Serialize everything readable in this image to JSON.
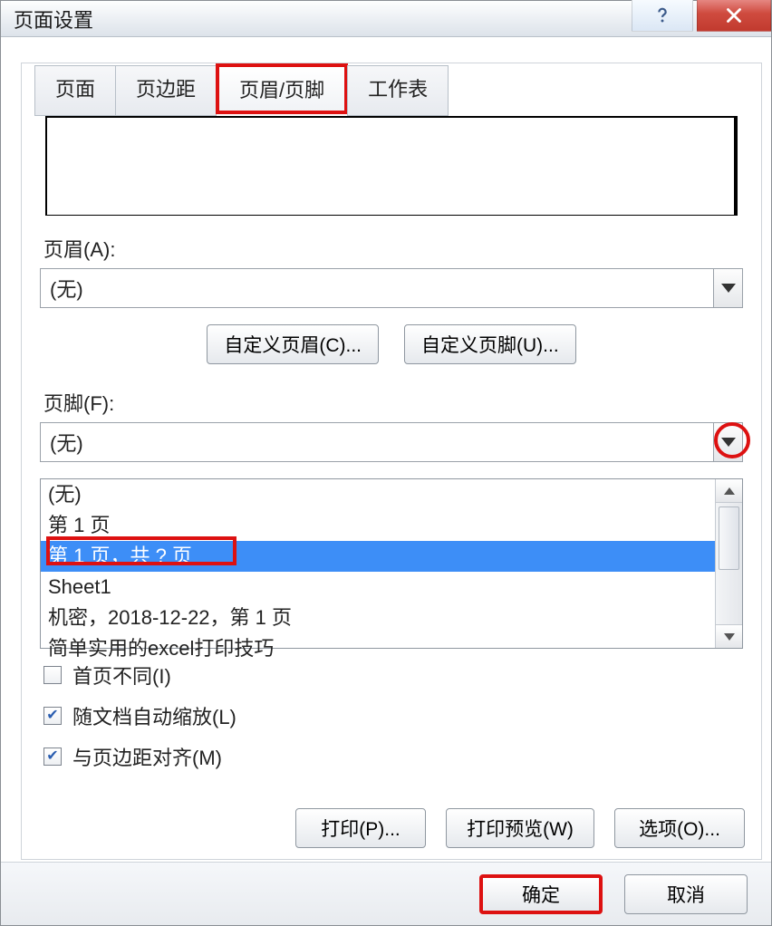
{
  "title": "页面设置",
  "tabs": {
    "page": "页面",
    "margins": "页边距",
    "headerFooter": "页眉/页脚",
    "sheet": "工作表"
  },
  "header": {
    "label": "页眉(A):",
    "value": "(无)"
  },
  "customHeaderBtn": "自定义页眉(C)...",
  "customFooterBtn": "自定义页脚(U)...",
  "footer": {
    "label": "页脚(F):",
    "value": "(无)"
  },
  "footerOptions": {
    "none": "(无)",
    "p1": "第 1 页",
    "p1ofN": "第 1 页，共 ? 页",
    "sheet": "Sheet1",
    "conf": "机密，2018-12-22，第 1 页",
    "tips": "简单实用的excel打印技巧"
  },
  "checks": {
    "diffFirst": "首页不同(I)",
    "scaleWithDoc": "随文档自动缩放(L)",
    "alignMargins": "与页边距对齐(M)"
  },
  "actions": {
    "print": "打印(P)...",
    "preview": "打印预览(W)",
    "options": "选项(O)..."
  },
  "dialog": {
    "ok": "确定",
    "cancel": "取消"
  }
}
